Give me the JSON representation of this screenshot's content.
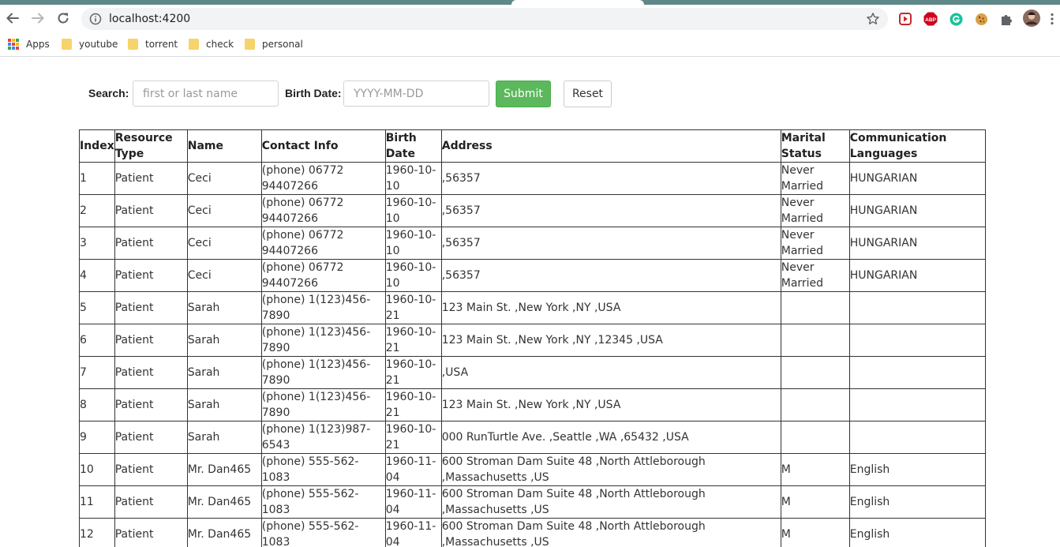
{
  "browser": {
    "url": "localhost:4200",
    "bookmarks": [
      "Apps",
      "youtube",
      "torrent",
      "check",
      "personal"
    ]
  },
  "search": {
    "search_label": "Search:",
    "name_placeholder": "first or last name",
    "birth_label": "Birth Date:",
    "date_placeholder": "YYYY-MM-DD",
    "submit_label": "Submit",
    "reset_label": "Reset"
  },
  "table": {
    "headers": [
      "Index",
      "Resource Type",
      "Name",
      "Contact Info",
      "Birth Date",
      "Address",
      "Marital Status",
      "Communication Languages"
    ],
    "rows": [
      [
        "1",
        "Patient",
        "Ceci",
        "(phone) 06772 94407266",
        "1960-10-10",
        ",56357",
        "Never Married",
        "HUNGARIAN"
      ],
      [
        "2",
        "Patient",
        "Ceci",
        "(phone) 06772 94407266",
        "1960-10-10",
        ",56357",
        "Never Married",
        "HUNGARIAN"
      ],
      [
        "3",
        "Patient",
        "Ceci",
        "(phone) 06772 94407266",
        "1960-10-10",
        ",56357",
        "Never Married",
        "HUNGARIAN"
      ],
      [
        "4",
        "Patient",
        "Ceci",
        "(phone) 06772 94407266",
        "1960-10-10",
        ",56357",
        "Never Married",
        "HUNGARIAN"
      ],
      [
        "5",
        "Patient",
        "Sarah",
        "(phone) 1(123)456-7890",
        "1960-10-21",
        "123 Main St. ,New York ,NY ,USA",
        "",
        ""
      ],
      [
        "6",
        "Patient",
        "Sarah",
        "(phone) 1(123)456-7890",
        "1960-10-21",
        "123 Main St. ,New York ,NY ,12345 ,USA",
        "",
        ""
      ],
      [
        "7",
        "Patient",
        "Sarah",
        "(phone) 1(123)456-7890",
        "1960-10-21",
        ",USA",
        "",
        ""
      ],
      [
        "8",
        "Patient",
        "Sarah",
        "(phone) 1(123)456-7890",
        "1960-10-21",
        "123 Main St. ,New York ,NY ,USA",
        "",
        ""
      ],
      [
        "9",
        "Patient",
        "Sarah",
        "(phone) 1(123)987-6543",
        "1960-10-21",
        "000 RunTurtle Ave. ,Seattle ,WA ,65432 ,USA",
        "",
        ""
      ],
      [
        "10",
        "Patient",
        "Mr. Dan465",
        "(phone) 555-562-1083",
        "1960-11-04",
        "600 Stroman Dam Suite 48 ,North Attleborough ,Massachusetts ,US",
        "M",
        "English"
      ],
      [
        "11",
        "Patient",
        "Mr. Dan465",
        "(phone) 555-562-1083",
        "1960-11-04",
        "600 Stroman Dam Suite 48 ,North Attleborough ,Massachusetts ,US",
        "M",
        "English"
      ],
      [
        "12",
        "Patient",
        "Mr. Dan465",
        "(phone) 555-562-1083",
        "1960-11-04",
        "600 Stroman Dam Suite 48 ,North Attleborough ,Massachusetts ,US",
        "M",
        "English"
      ]
    ]
  },
  "icons": {
    "back": "back-arrow-icon",
    "forward": "forward-arrow-icon",
    "reload": "reload-icon",
    "site_info": "info-icon",
    "bookmark_star": "star-icon",
    "extensions": [
      "video-extension-icon",
      "adblock-plus-icon",
      "grammarly-icon",
      "cookie-icon",
      "puzzle-icon",
      "profile-avatar"
    ]
  },
  "colors": {
    "submit_bg": "#5cb85c",
    "tabstrip": "#5f8888",
    "abp_red": "#d0021b",
    "grammarly_green": "#15c39a"
  }
}
